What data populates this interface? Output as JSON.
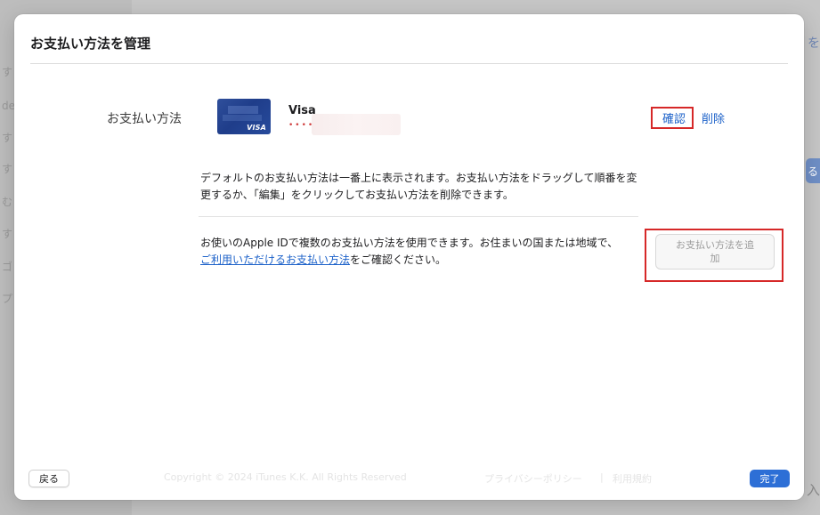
{
  "background": {
    "left_glyphs": [
      "す",
      "de",
      "す",
      "す",
      "む",
      "す",
      "ゴ",
      "プ"
    ],
    "right_text": "を",
    "right_button_label": "る",
    "bottom_right_text": "入"
  },
  "dialog": {
    "title": "お支払い方法を管理",
    "payment_label": "お支払い方法",
    "card": {
      "brand": "Visa",
      "art_text": "VISA",
      "masked_number": "••••"
    },
    "actions": {
      "confirm_label": "確認",
      "delete_label": "削除"
    },
    "info_text": "デフォルトのお支払い方法は一番上に表示されます。お支払い方法をドラッグして順番を変更するか、「編集」をクリックしてお支払い方法を削除できます。",
    "multi_text_before": "お使いのApple IDで複数のお支払い方法を使用できます。お住まいの国または地域で、",
    "multi_link": "ご利用いただけるお支払い方法",
    "multi_text_after": "をご確認ください。",
    "add_button_label": "お支払い方法を追加",
    "back_button_label": "戻る",
    "done_button_label": "完了"
  },
  "footer_behind": {
    "copyright": "Copyright © 2024 iTunes K.K. All Rights Reserved",
    "privacy_label": "プライバシーポリシー",
    "separator": "|",
    "terms_label": "利用規約"
  },
  "colors": {
    "accent": "#1d62c9",
    "primary_button": "#2d6fd6",
    "highlight_box": "#d62828",
    "card_blue": "#1f3d8a"
  }
}
